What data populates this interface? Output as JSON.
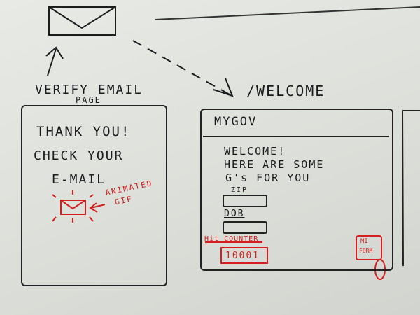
{
  "left_page": {
    "heading_line1": "VERIFY EMAIL",
    "heading_line2": "PAGE",
    "body_line1": "THANK YOU!",
    "body_line2": "CHECK YOUR",
    "body_line3": "E-MAIL",
    "annotation_line1": "ANIMATED",
    "annotation_line2": "GIF"
  },
  "right_page": {
    "heading": "/WELCOME",
    "brand": "MYGOV",
    "body_line1": "WELCOME!",
    "body_line2": "HERE ARE SOME",
    "body_line3": "G's FOR YOU",
    "field1_label": "ZIP",
    "field2_label": "DOB",
    "counter_label": "Hit COUNTER",
    "counter_value": "10001",
    "badge_line1": "MI",
    "badge_line2": "FORM"
  },
  "colors": {
    "ink": "#1b1b1e",
    "marker_red": "#d3201e",
    "board": "#e2e4df"
  },
  "icons": [
    "envelope-icon",
    "arrow-up-icon",
    "dashed-arrow-icon",
    "animated-envelope-icon"
  ]
}
